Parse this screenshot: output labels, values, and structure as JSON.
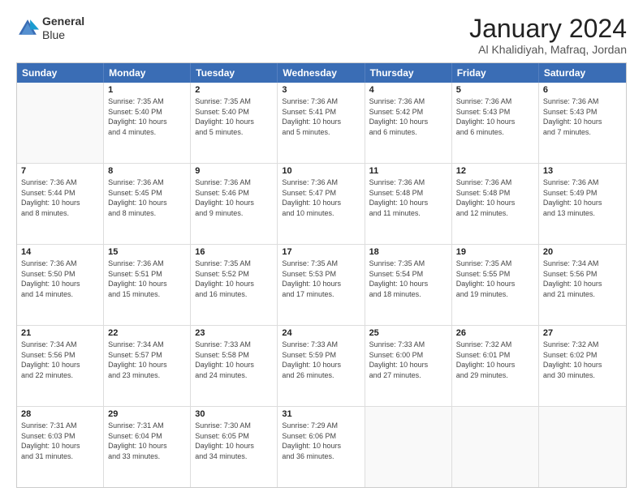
{
  "logo": {
    "line1": "General",
    "line2": "Blue"
  },
  "title": "January 2024",
  "location": "Al Khalidiyah, Mafraq, Jordan",
  "header_days": [
    "Sunday",
    "Monday",
    "Tuesday",
    "Wednesday",
    "Thursday",
    "Friday",
    "Saturday"
  ],
  "rows": [
    [
      {
        "num": "",
        "lines": []
      },
      {
        "num": "1",
        "lines": [
          "Sunrise: 7:35 AM",
          "Sunset: 5:40 PM",
          "Daylight: 10 hours",
          "and 4 minutes."
        ]
      },
      {
        "num": "2",
        "lines": [
          "Sunrise: 7:35 AM",
          "Sunset: 5:40 PM",
          "Daylight: 10 hours",
          "and 5 minutes."
        ]
      },
      {
        "num": "3",
        "lines": [
          "Sunrise: 7:36 AM",
          "Sunset: 5:41 PM",
          "Daylight: 10 hours",
          "and 5 minutes."
        ]
      },
      {
        "num": "4",
        "lines": [
          "Sunrise: 7:36 AM",
          "Sunset: 5:42 PM",
          "Daylight: 10 hours",
          "and 6 minutes."
        ]
      },
      {
        "num": "5",
        "lines": [
          "Sunrise: 7:36 AM",
          "Sunset: 5:43 PM",
          "Daylight: 10 hours",
          "and 6 minutes."
        ]
      },
      {
        "num": "6",
        "lines": [
          "Sunrise: 7:36 AM",
          "Sunset: 5:43 PM",
          "Daylight: 10 hours",
          "and 7 minutes."
        ]
      }
    ],
    [
      {
        "num": "7",
        "lines": [
          "Sunrise: 7:36 AM",
          "Sunset: 5:44 PM",
          "Daylight: 10 hours",
          "and 8 minutes."
        ]
      },
      {
        "num": "8",
        "lines": [
          "Sunrise: 7:36 AM",
          "Sunset: 5:45 PM",
          "Daylight: 10 hours",
          "and 8 minutes."
        ]
      },
      {
        "num": "9",
        "lines": [
          "Sunrise: 7:36 AM",
          "Sunset: 5:46 PM",
          "Daylight: 10 hours",
          "and 9 minutes."
        ]
      },
      {
        "num": "10",
        "lines": [
          "Sunrise: 7:36 AM",
          "Sunset: 5:47 PM",
          "Daylight: 10 hours",
          "and 10 minutes."
        ]
      },
      {
        "num": "11",
        "lines": [
          "Sunrise: 7:36 AM",
          "Sunset: 5:48 PM",
          "Daylight: 10 hours",
          "and 11 minutes."
        ]
      },
      {
        "num": "12",
        "lines": [
          "Sunrise: 7:36 AM",
          "Sunset: 5:48 PM",
          "Daylight: 10 hours",
          "and 12 minutes."
        ]
      },
      {
        "num": "13",
        "lines": [
          "Sunrise: 7:36 AM",
          "Sunset: 5:49 PM",
          "Daylight: 10 hours",
          "and 13 minutes."
        ]
      }
    ],
    [
      {
        "num": "14",
        "lines": [
          "Sunrise: 7:36 AM",
          "Sunset: 5:50 PM",
          "Daylight: 10 hours",
          "and 14 minutes."
        ]
      },
      {
        "num": "15",
        "lines": [
          "Sunrise: 7:36 AM",
          "Sunset: 5:51 PM",
          "Daylight: 10 hours",
          "and 15 minutes."
        ]
      },
      {
        "num": "16",
        "lines": [
          "Sunrise: 7:35 AM",
          "Sunset: 5:52 PM",
          "Daylight: 10 hours",
          "and 16 minutes."
        ]
      },
      {
        "num": "17",
        "lines": [
          "Sunrise: 7:35 AM",
          "Sunset: 5:53 PM",
          "Daylight: 10 hours",
          "and 17 minutes."
        ]
      },
      {
        "num": "18",
        "lines": [
          "Sunrise: 7:35 AM",
          "Sunset: 5:54 PM",
          "Daylight: 10 hours",
          "and 18 minutes."
        ]
      },
      {
        "num": "19",
        "lines": [
          "Sunrise: 7:35 AM",
          "Sunset: 5:55 PM",
          "Daylight: 10 hours",
          "and 19 minutes."
        ]
      },
      {
        "num": "20",
        "lines": [
          "Sunrise: 7:34 AM",
          "Sunset: 5:56 PM",
          "Daylight: 10 hours",
          "and 21 minutes."
        ]
      }
    ],
    [
      {
        "num": "21",
        "lines": [
          "Sunrise: 7:34 AM",
          "Sunset: 5:56 PM",
          "Daylight: 10 hours",
          "and 22 minutes."
        ]
      },
      {
        "num": "22",
        "lines": [
          "Sunrise: 7:34 AM",
          "Sunset: 5:57 PM",
          "Daylight: 10 hours",
          "and 23 minutes."
        ]
      },
      {
        "num": "23",
        "lines": [
          "Sunrise: 7:33 AM",
          "Sunset: 5:58 PM",
          "Daylight: 10 hours",
          "and 24 minutes."
        ]
      },
      {
        "num": "24",
        "lines": [
          "Sunrise: 7:33 AM",
          "Sunset: 5:59 PM",
          "Daylight: 10 hours",
          "and 26 minutes."
        ]
      },
      {
        "num": "25",
        "lines": [
          "Sunrise: 7:33 AM",
          "Sunset: 6:00 PM",
          "Daylight: 10 hours",
          "and 27 minutes."
        ]
      },
      {
        "num": "26",
        "lines": [
          "Sunrise: 7:32 AM",
          "Sunset: 6:01 PM",
          "Daylight: 10 hours",
          "and 29 minutes."
        ]
      },
      {
        "num": "27",
        "lines": [
          "Sunrise: 7:32 AM",
          "Sunset: 6:02 PM",
          "Daylight: 10 hours",
          "and 30 minutes."
        ]
      }
    ],
    [
      {
        "num": "28",
        "lines": [
          "Sunrise: 7:31 AM",
          "Sunset: 6:03 PM",
          "Daylight: 10 hours",
          "and 31 minutes."
        ]
      },
      {
        "num": "29",
        "lines": [
          "Sunrise: 7:31 AM",
          "Sunset: 6:04 PM",
          "Daylight: 10 hours",
          "and 33 minutes."
        ]
      },
      {
        "num": "30",
        "lines": [
          "Sunrise: 7:30 AM",
          "Sunset: 6:05 PM",
          "Daylight: 10 hours",
          "and 34 minutes."
        ]
      },
      {
        "num": "31",
        "lines": [
          "Sunrise: 7:29 AM",
          "Sunset: 6:06 PM",
          "Daylight: 10 hours",
          "and 36 minutes."
        ]
      },
      {
        "num": "",
        "lines": []
      },
      {
        "num": "",
        "lines": []
      },
      {
        "num": "",
        "lines": []
      }
    ]
  ]
}
